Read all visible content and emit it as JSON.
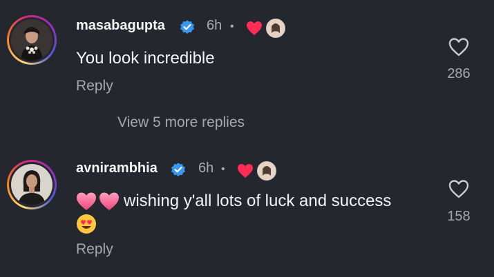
{
  "comments": [
    {
      "username": "masabagupta",
      "time": "6h",
      "separator": "•",
      "text": "You look incredible",
      "reply_label": "Reply",
      "like_count": "286"
    },
    {
      "username": "avnirambhia",
      "time": "6h",
      "separator": "•",
      "text": "wishing y'all lots of luck and success",
      "reply_label": "Reply",
      "like_count": "158"
    }
  ],
  "view_more": "View 5 more replies",
  "colors": {
    "background": "#25272e",
    "verified": "#3897f0",
    "heart": "#ff2d55",
    "secondary_text": "#a6a9b1"
  },
  "icons": [
    "verified-badge-icon",
    "heart-icon",
    "like-heart-outline-icon",
    "pink-heart-emoji",
    "heart-eyes-emoji"
  ]
}
